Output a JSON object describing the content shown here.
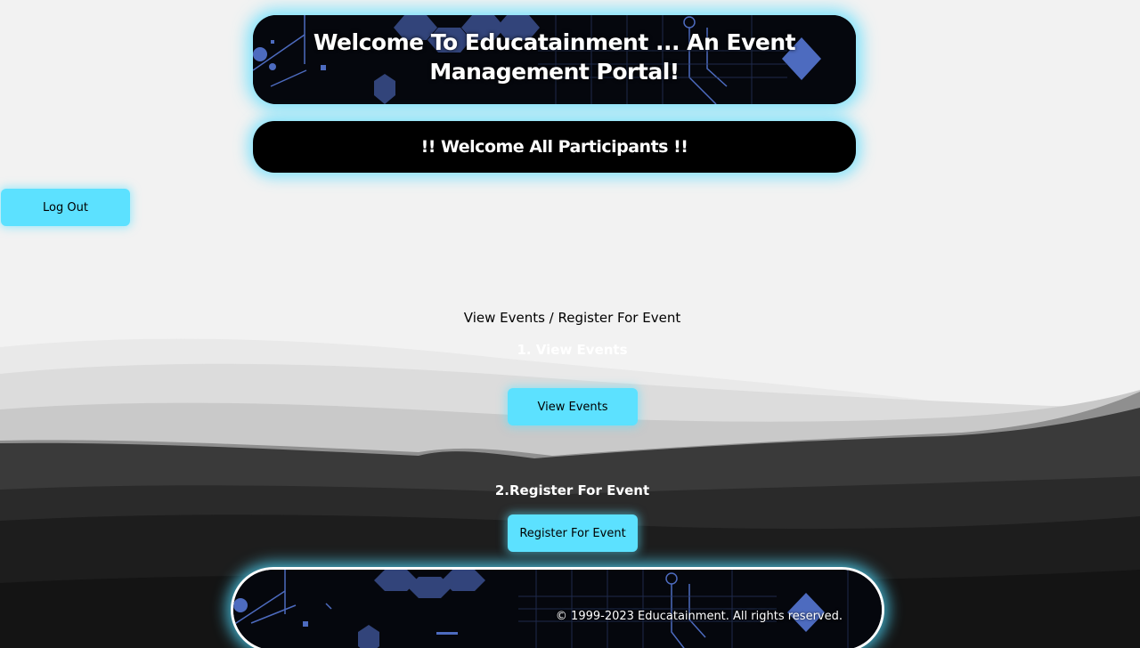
{
  "header": {
    "title": "Welcome To Educatainment ... An Event Management Portal!"
  },
  "welcome": {
    "text": "!! Welcome All Participants !!"
  },
  "actions": {
    "logout_label": "Log Out"
  },
  "main": {
    "heading": "View Events / Register For Event",
    "step_one": "1. View Events",
    "view_button": "View Events",
    "step_two": "2.Register For Event",
    "register_button": "Register For Event"
  },
  "footer": {
    "copyright": "© 1999-2023 Educatainment. All rights reserved."
  },
  "colors": {
    "accent": "#5ce1ff",
    "glow": "#50dcff",
    "banner_bg": "#05070d",
    "page_bg": "#f2f2f2"
  }
}
